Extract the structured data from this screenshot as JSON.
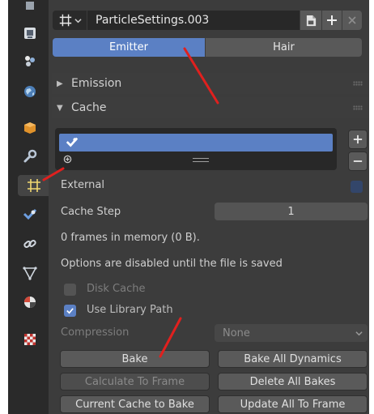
{
  "header": {
    "datablock_name": "ParticleSettings.003",
    "icons": [
      "particles-icon",
      "chevron-down-icon",
      "fake-user-icon",
      "add-icon",
      "close-icon"
    ]
  },
  "particle_type": {
    "options": [
      "Emitter",
      "Hair"
    ],
    "selected": "Emitter"
  },
  "panels": {
    "emission": "Emission",
    "cache": "Cache"
  },
  "cache": {
    "external_label": "External",
    "cache_step_label": "Cache Step",
    "cache_step_value": "1",
    "frames_info": "0 frames in memory (0 B).",
    "disabled_notice": "Options are disabled until the file is saved",
    "disk_cache_label": "Disk Cache",
    "disk_cache_checked": false,
    "use_library_path_label": "Use Library Path",
    "use_library_path_checked": true,
    "compression_label": "Compression",
    "compression_value": "None"
  },
  "buttons": {
    "bake": "Bake",
    "bake_all_dynamics": "Bake All Dynamics",
    "calculate_to_frame": "Calculate To Frame",
    "delete_all_bakes": "Delete All Bakes",
    "current_cache_to_bake": "Current Cache to Bake",
    "update_all_to_frame": "Update All To Frame"
  },
  "colors": {
    "accent": "#5b80c4",
    "annotation": "#e0201e"
  }
}
